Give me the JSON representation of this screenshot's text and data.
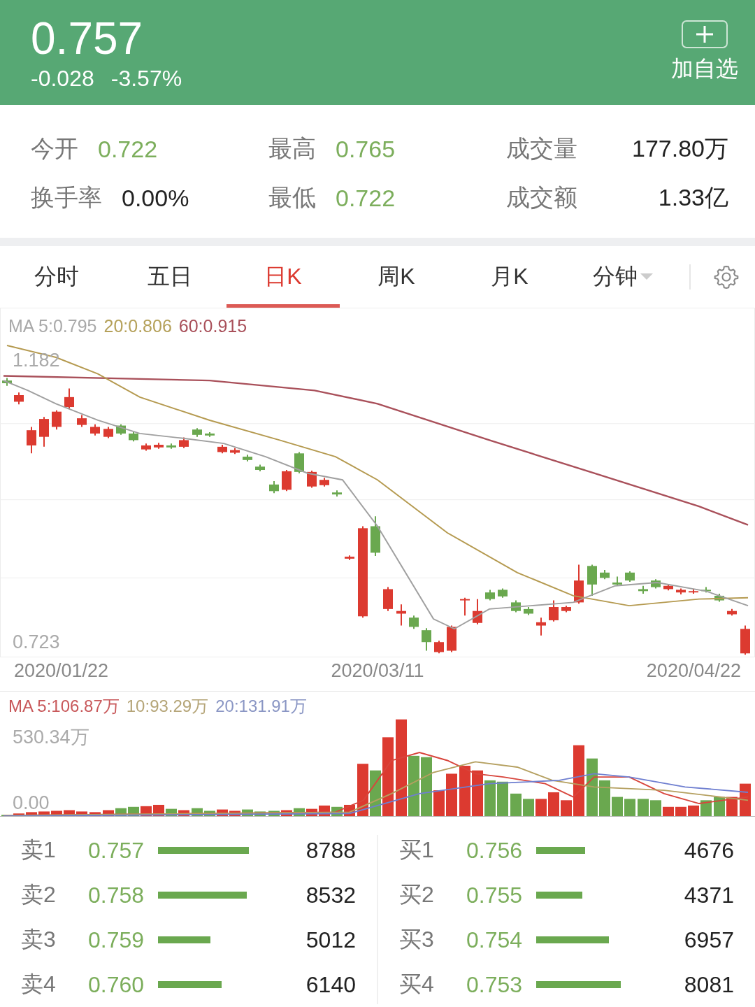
{
  "header": {
    "price": "0.757",
    "change": "-0.028",
    "change_percent": "-3.57%",
    "watch_button": "加自选"
  },
  "stats": [
    {
      "label": "今开",
      "value": "0.722",
      "kind": "price"
    },
    {
      "label": "最高",
      "value": "0.765",
      "kind": "price"
    },
    {
      "label": "成交量",
      "value": "177.80万",
      "kind": "plain"
    },
    {
      "label": "换手率",
      "value": "0.00%",
      "kind": "plain"
    },
    {
      "label": "最低",
      "value": "0.722",
      "kind": "price"
    },
    {
      "label": "成交额",
      "value": "1.33亿",
      "kind": "plain"
    }
  ],
  "tabs": [
    {
      "label": "分时",
      "selected": false,
      "kind": "tab"
    },
    {
      "label": "五日",
      "selected": false,
      "kind": "tab"
    },
    {
      "label": "日K",
      "selected": true,
      "kind": "tab"
    },
    {
      "label": "周K",
      "selected": false,
      "kind": "tab"
    },
    {
      "label": "月K",
      "selected": false,
      "kind": "tab"
    },
    {
      "label": "分钟",
      "selected": false,
      "kind": "dropdown"
    }
  ],
  "kline": {
    "legend": [
      {
        "text": "MA 5:0.795",
        "color": "#a9a9a9"
      },
      {
        "text": "20:0.806",
        "color": "#b5a15a"
      },
      {
        "text": "60:0.915",
        "color": "#a9505a"
      }
    ],
    "high_label": "1.182",
    "low_label": "0.723",
    "dates": [
      "2020/01/22",
      "2020/03/11",
      "2020/04/22"
    ]
  },
  "volume": {
    "legend": [
      {
        "text": "MA 5:106.87万",
        "color": "#c8585a"
      },
      {
        "text": "10:93.29万",
        "color": "#b5a578"
      },
      {
        "text": "20:131.91万",
        "color": "#8a96c4"
      }
    ],
    "max_label": "530.34万",
    "min_label": "0.00"
  },
  "order_book": {
    "sell": [
      {
        "label": "卖1",
        "price": "0.757",
        "volume": "8788"
      },
      {
        "label": "卖2",
        "price": "0.758",
        "volume": "8532"
      },
      {
        "label": "卖3",
        "price": "0.759",
        "volume": "5012"
      },
      {
        "label": "卖4",
        "price": "0.760",
        "volume": "6140"
      }
    ],
    "buy": [
      {
        "label": "买1",
        "price": "0.756",
        "volume": "4676"
      },
      {
        "label": "买2",
        "price": "0.755",
        "volume": "4371"
      },
      {
        "label": "买3",
        "price": "0.754",
        "volume": "6957"
      },
      {
        "label": "买4",
        "price": "0.753",
        "volume": "8081"
      }
    ]
  }
}
